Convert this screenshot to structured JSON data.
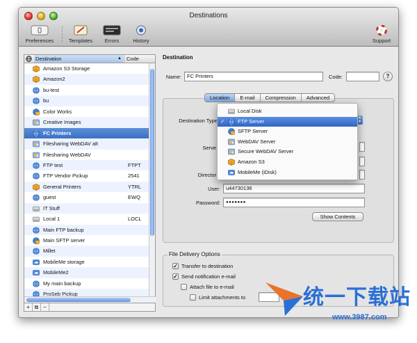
{
  "window": {
    "title": "Destinations"
  },
  "toolbar": {
    "preferences_label": "Preferences",
    "templates_label": "Templates",
    "errors_label": "Errors",
    "history_label": "History",
    "support_label": "Support"
  },
  "list": {
    "header_destination": "Destination",
    "header_code": "Code",
    "items": [
      {
        "label": "Amazon S3 Storage",
        "code": "",
        "icon": "amazon-box-icon"
      },
      {
        "label": "Amazon2",
        "code": "",
        "icon": "amazon-box-icon"
      },
      {
        "label": "bu-test",
        "code": "",
        "icon": "globe-icon"
      },
      {
        "label": "bu",
        "code": "",
        "icon": "globe-icon"
      },
      {
        "label": "Color Works",
        "code": "",
        "icon": "globe-share-icon"
      },
      {
        "label": "Creative Images",
        "code": "",
        "icon": "webdav-icon"
      },
      {
        "label": "FC Printers",
        "code": "",
        "icon": "globe-icon"
      },
      {
        "label": "Filesharing WebDAV alt",
        "code": "",
        "icon": "webdav-icon"
      },
      {
        "label": "Filesharing WebDAV",
        "code": "",
        "icon": "webdav-icon"
      },
      {
        "label": "FTP test",
        "code": "FTPT",
        "icon": "globe-icon"
      },
      {
        "label": "FTP Vendor Pickup",
        "code": "2541",
        "icon": "globe-icon"
      },
      {
        "label": "General Printers",
        "code": "YTRL",
        "icon": "amazon-box-icon"
      },
      {
        "label": "guest",
        "code": "EWQ",
        "icon": "globe-icon"
      },
      {
        "label": "IT Stuff",
        "code": "",
        "icon": "disk-icon"
      },
      {
        "label": "Local 1",
        "code": "LOCL",
        "icon": "disk-icon"
      },
      {
        "label": "Main FTP backup",
        "code": "",
        "icon": "globe-icon"
      },
      {
        "label": "Main SFTP server",
        "code": "",
        "icon": "globe-share-icon"
      },
      {
        "label": "Millet",
        "code": "",
        "icon": "globe-icon"
      },
      {
        "label": "MobileMe storage",
        "code": "",
        "icon": "mobileme-icon"
      },
      {
        "label": "MobileMe2",
        "code": "",
        "icon": "mobileme-icon"
      },
      {
        "label": "My main backup",
        "code": "",
        "icon": "globe-icon"
      },
      {
        "label": "ProSeb Pickup",
        "code": "",
        "icon": "globe-icon"
      }
    ],
    "buttons": [
      "+",
      "⧉",
      "−"
    ]
  },
  "destination": {
    "section_title": "Destination",
    "name_label": "Name:",
    "name_value": "FC Printers",
    "code_label": "Code:",
    "code_value": "",
    "help": "?"
  },
  "tabs": [
    "Location",
    "E-mail",
    "Compression",
    "Advanced"
  ],
  "location": {
    "type_label": "Destination Type",
    "server_label": "Serve",
    "director_label": "Director",
    "user_label": "User:",
    "user_value": "u44730136",
    "password_label": "Password:",
    "password_value": "●●●●●●●",
    "show_contents": "Show Contents"
  },
  "dropdown": {
    "items": [
      {
        "label": "Local Disk",
        "icon": "disk-icon",
        "checked": false
      },
      {
        "label": "FTP Server",
        "icon": "globe-icon",
        "checked": true
      },
      {
        "label": "SFTP Server",
        "icon": "globe-share-icon",
        "checked": false
      },
      {
        "label": "WebDAV Server",
        "icon": "webdav-icon",
        "checked": false
      },
      {
        "label": "Secure WebDAV Server",
        "icon": "webdav-icon",
        "checked": false
      },
      {
        "label": "Amazon S3",
        "icon": "amazon-box-icon",
        "checked": false
      },
      {
        "label": "MobileMe (iDisk)",
        "icon": "mobileme-icon",
        "checked": false
      }
    ],
    "check_glyph": "✓"
  },
  "delivery": {
    "section_title": "File Delivery Options",
    "transfer": "Transfer to destination",
    "notify": "Send notification e-mail",
    "attach": "Attach file to e-mail",
    "limit": "Limit attachments to",
    "limit_suffix": "MB"
  },
  "watermark": {
    "text": "统一下载站",
    "url": "www.3987.com"
  },
  "colors": {
    "selection": "#3a6fc4",
    "accent": "#2a6fd6"
  }
}
